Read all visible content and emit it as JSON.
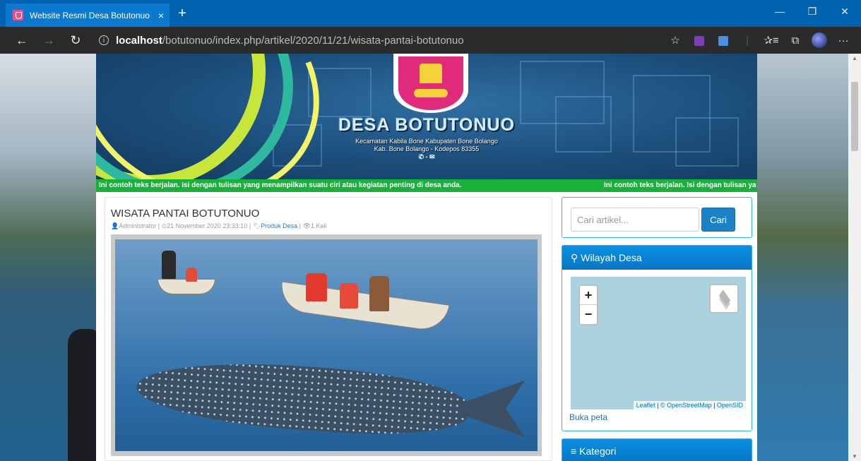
{
  "browser": {
    "tab_title": "Website Resmi Desa Botutonuo",
    "tab_close": "×",
    "new_tab": "+",
    "url_host": "localhost",
    "url_path": "/botutonuo/index.php/artikel/2020/11/21/wisata-pantai-botutonuo",
    "nav": {
      "back": "←",
      "forward": "→",
      "refresh": "↻"
    },
    "window": {
      "minimize": "—",
      "restore": "❐",
      "close": "✕"
    },
    "tools": {
      "favorite": "☆",
      "favorites_list": "✰≡",
      "collections": "⧉",
      "more": "···"
    },
    "icons": [
      "favicon-icon",
      "info-icon",
      "star-icon",
      "extension-icon",
      "reading-icon",
      "favorites-icon",
      "collections-icon",
      "profile-icon",
      "more-icon"
    ]
  },
  "header": {
    "site_title": "DESA BOTUTONUO",
    "subtitle_1": "Kecamatan Kabila Bone Kabupaten Bone Bolango",
    "subtitle_2": "Kab. Bone Bolango - Kodepos 83355",
    "contact_icons": "✆ - ✉"
  },
  "ticker": {
    "text": "Ini contoh teks berjalan. Isi dengan tulisan yang menampilkan suatu ciri atau kegiatan penting di desa anda.",
    "text_repeat": "Ini contoh teks berjalan. Isi dengan tulisan ya"
  },
  "article": {
    "title": "WISATA PANTAI BOTUTONUO",
    "author": "Administrator",
    "date": "21 November 2020 23:33:10",
    "category": "Produk Desa",
    "views": "1 Kali",
    "sep": "|"
  },
  "sidebar": {
    "search_placeholder": "Cari artikel...",
    "search_button": "Cari",
    "region_title": "Wilayah Desa",
    "zoom_in": "+",
    "zoom_out": "−",
    "attribution_leaflet": "Leaflet",
    "attribution_osm": "© OpenStreetMap",
    "attribution_opensid": "OpenSID",
    "open_map": "Buka peta",
    "category_title": "Kategori"
  },
  "colors": {
    "titlebar": "#0063b1",
    "navbar": "#2b2b2b",
    "ticker": "#16b23a",
    "widget_head": "#0a8fe0",
    "link": "#337ab7"
  }
}
